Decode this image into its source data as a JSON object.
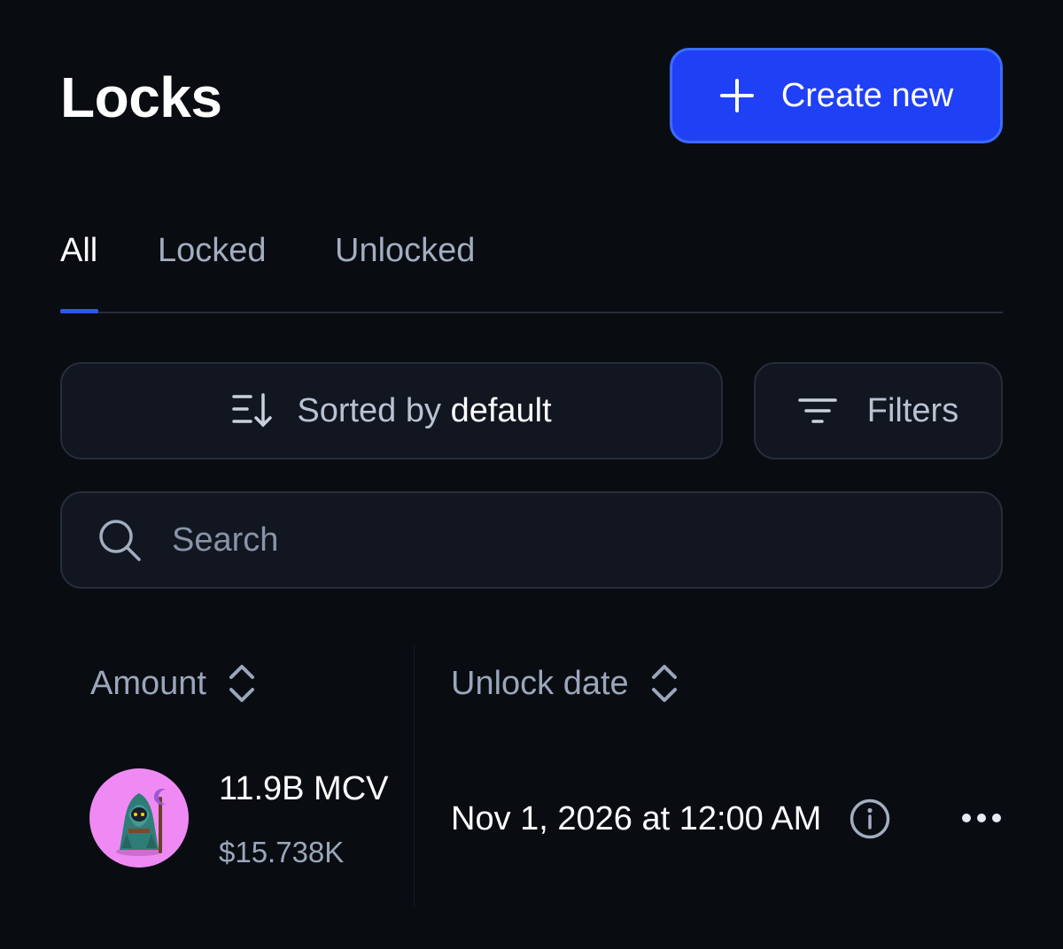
{
  "header": {
    "title": "Locks",
    "create_label": "Create new",
    "create_icon": "plus-icon"
  },
  "tabs": [
    {
      "label": "All",
      "active": true
    },
    {
      "label": "Locked",
      "active": false
    },
    {
      "label": "Unlocked",
      "active": false
    }
  ],
  "controls": {
    "sort_prefix": "Sorted by",
    "sort_value": "default",
    "sort_icon": "sort-descending-icon",
    "filters_label": "Filters",
    "filters_icon": "filter-icon",
    "search_placeholder": "Search",
    "search_value": "",
    "search_icon": "search-icon"
  },
  "table": {
    "columns": [
      {
        "label": "Amount",
        "icon": "sort-updown-icon"
      },
      {
        "label": "Unlock date",
        "icon": "sort-updown-icon"
      }
    ],
    "rows": [
      {
        "token_icon": "wizard-token-icon",
        "amount": "11.9B MCV",
        "usd_value": "$15.738K",
        "unlock_date": "Nov 1, 2026 at 12:00 AM",
        "info_icon": "info-icon",
        "menu_icon": "more-icon"
      }
    ]
  },
  "colors": {
    "background": "#090c11",
    "accent": "#1f40f5",
    "tab_indicator": "#2f56f2",
    "avatar_bg": "#ef8af4"
  }
}
